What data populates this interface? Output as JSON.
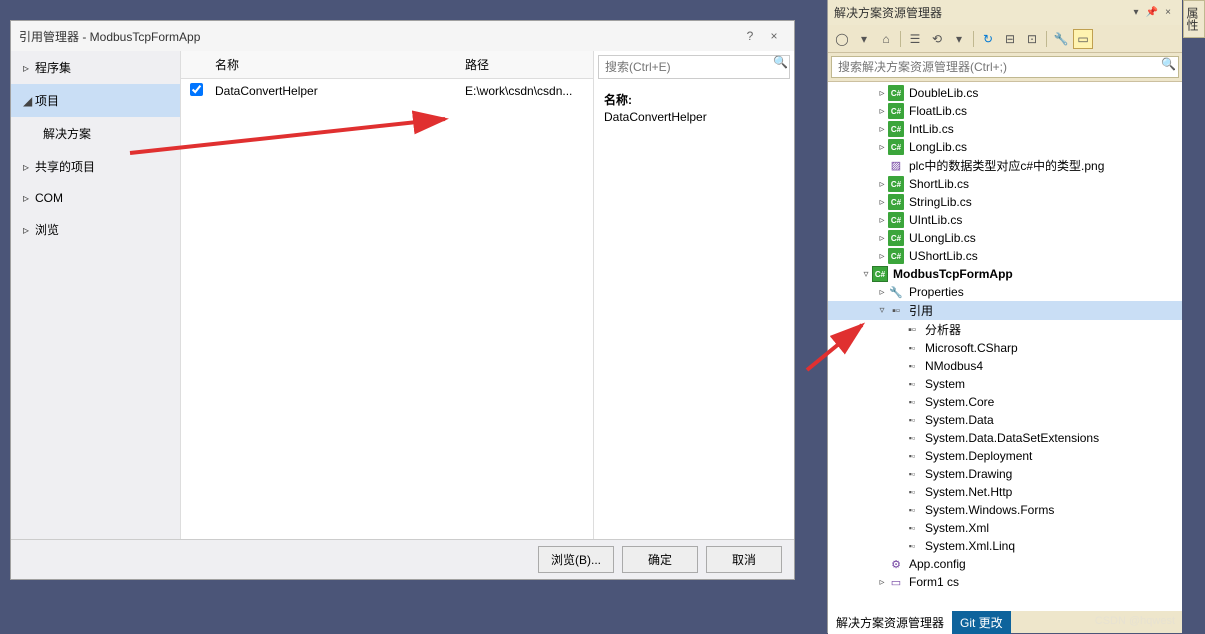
{
  "dialog": {
    "title": "引用管理器 - ModbusTcpFormApp",
    "help": "?",
    "close": "×",
    "nav": {
      "assemblies": "程序集",
      "projects": "项目",
      "solution": "解决方案",
      "shared": "共享的项目",
      "com": "COM",
      "browse": "浏览"
    },
    "list": {
      "header_name": "名称",
      "header_path": "路径",
      "rows": [
        {
          "checked": true,
          "name": "DataConvertHelper",
          "path": "E:\\work\\csdn\\csdn..."
        }
      ]
    },
    "search": {
      "placeholder": "搜索(Ctrl+E)"
    },
    "detail": {
      "label": "名称:",
      "value": "DataConvertHelper"
    },
    "footer": {
      "browse": "浏览(B)...",
      "ok": "确定",
      "cancel": "取消"
    }
  },
  "explorer": {
    "title": "解决方案资源管理器",
    "search_placeholder": "搜索解决方案资源管理器(Ctrl+;)",
    "tree": [
      {
        "indent": 2,
        "caret": "▹",
        "icon": "cs",
        "text": "DoubleLib.cs"
      },
      {
        "indent": 2,
        "caret": "▹",
        "icon": "cs",
        "text": "FloatLib.cs"
      },
      {
        "indent": 2,
        "caret": "▹",
        "icon": "cs",
        "text": "IntLib.cs"
      },
      {
        "indent": 2,
        "caret": "▹",
        "icon": "cs",
        "text": "LongLib.cs"
      },
      {
        "indent": 2,
        "caret": "",
        "icon": "png",
        "text": "plc中的数据类型对应c#中的类型.png"
      },
      {
        "indent": 2,
        "caret": "▹",
        "icon": "cs",
        "text": "ShortLib.cs"
      },
      {
        "indent": 2,
        "caret": "▹",
        "icon": "cs",
        "text": "StringLib.cs"
      },
      {
        "indent": 2,
        "caret": "▹",
        "icon": "cs",
        "text": "UIntLib.cs"
      },
      {
        "indent": 2,
        "caret": "▹",
        "icon": "cs",
        "text": "ULongLib.cs"
      },
      {
        "indent": 2,
        "caret": "▹",
        "icon": "cs",
        "text": "UShortLib.cs"
      },
      {
        "indent": 1,
        "caret": "▿",
        "icon": "proj",
        "text": "ModbusTcpFormApp",
        "bold": true
      },
      {
        "indent": 2,
        "caret": "▹",
        "icon": "wrench",
        "text": "Properties"
      },
      {
        "indent": 2,
        "caret": "▿",
        "icon": "ref",
        "text": "引用",
        "sel": true
      },
      {
        "indent": 3,
        "caret": "",
        "icon": "ref",
        "text": "分析器"
      },
      {
        "indent": 3,
        "caret": "",
        "icon": "asm",
        "text": "Microsoft.CSharp"
      },
      {
        "indent": 3,
        "caret": "",
        "icon": "asm",
        "text": "NModbus4"
      },
      {
        "indent": 3,
        "caret": "",
        "icon": "asm",
        "text": "System"
      },
      {
        "indent": 3,
        "caret": "",
        "icon": "asm",
        "text": "System.Core"
      },
      {
        "indent": 3,
        "caret": "",
        "icon": "asm",
        "text": "System.Data"
      },
      {
        "indent": 3,
        "caret": "",
        "icon": "asm",
        "text": "System.Data.DataSetExtensions"
      },
      {
        "indent": 3,
        "caret": "",
        "icon": "asm",
        "text": "System.Deployment"
      },
      {
        "indent": 3,
        "caret": "",
        "icon": "asm",
        "text": "System.Drawing"
      },
      {
        "indent": 3,
        "caret": "",
        "icon": "asm",
        "text": "System.Net.Http"
      },
      {
        "indent": 3,
        "caret": "",
        "icon": "asm",
        "text": "System.Windows.Forms"
      },
      {
        "indent": 3,
        "caret": "",
        "icon": "asm",
        "text": "System.Xml"
      },
      {
        "indent": 3,
        "caret": "",
        "icon": "asm",
        "text": "System.Xml.Linq"
      },
      {
        "indent": 2,
        "caret": "",
        "icon": "cfg",
        "text": "App.config"
      },
      {
        "indent": 2,
        "caret": "▹",
        "icon": "form",
        "text": "Form1 cs"
      }
    ],
    "footer": {
      "tab1": "解决方案资源管理器",
      "tab2": "Git 更改"
    }
  },
  "edge_tab": "属性",
  "watermark": "CSDN @hqwest"
}
